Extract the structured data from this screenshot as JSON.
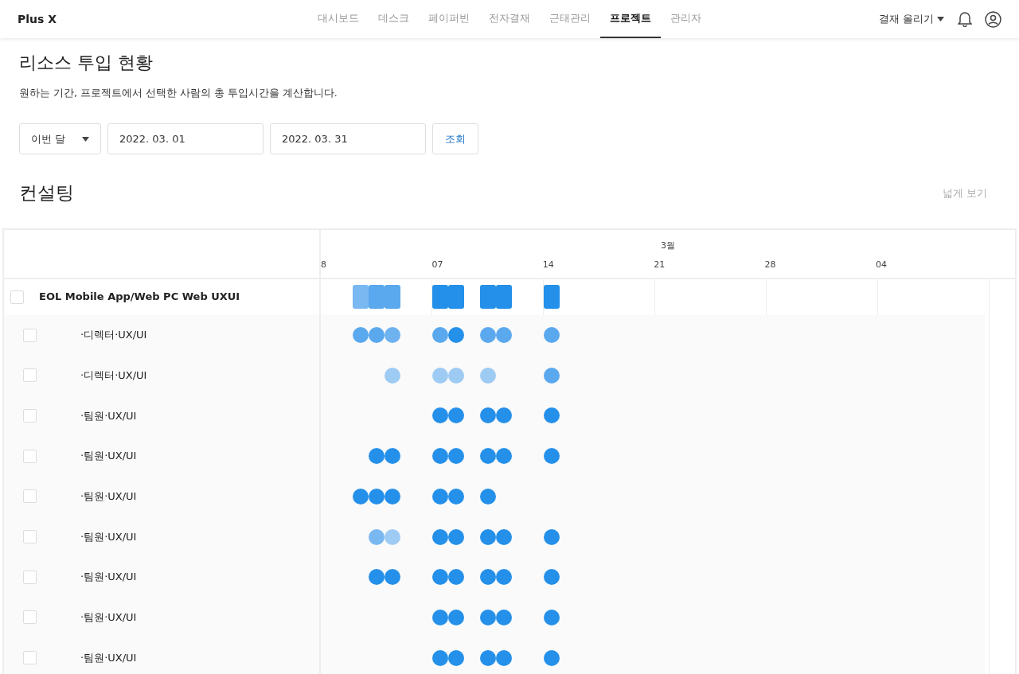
{
  "brand": "Plus X",
  "nav": [
    {
      "label": "대시보드",
      "selected": false
    },
    {
      "label": "데스크",
      "selected": false
    },
    {
      "label": "페이퍼빈",
      "selected": false
    },
    {
      "label": "전자결재",
      "selected": false
    },
    {
      "label": "근태관리",
      "selected": false
    },
    {
      "label": "프로젝트",
      "selected": true
    },
    {
      "label": "관리자",
      "selected": false
    }
  ],
  "approval_menu": "결재 올리기",
  "page": {
    "title": "리소스 투입 현황",
    "description": "원하는 기간, 프로젝트에서 선택한 사람의 총 투입시간을 계산합니다."
  },
  "filters": {
    "period": "이번 달",
    "start_date": "2022. 03. 01",
    "end_date": "2022. 03. 31",
    "search_button": "조회"
  },
  "section": {
    "title": "컨설팅",
    "expand_link": "넓게 보기"
  },
  "timeline": {
    "month": "3월",
    "ticks": [
      "8",
      "07",
      "14",
      "21",
      "28",
      "04"
    ]
  },
  "rows": [
    {
      "kind": "project",
      "label": "EOL Mobile App/Web PC Web UXUI",
      "checked": false,
      "days": [
        {
          "booked": false
        },
        {
          "booked": false
        },
        {
          "booked": true,
          "color": "#7ab8f2"
        },
        {
          "booked": true,
          "color": "#5aa8ee"
        },
        {
          "booked": true,
          "color": "#5aa8ee"
        },
        {
          "booked": false
        },
        {
          "booked": false
        },
        {
          "booked": true,
          "color": "#2490ea"
        },
        {
          "booked": true,
          "color": "#2490ea"
        },
        {
          "booked": false
        },
        {
          "booked": true,
          "color": "#2490ea"
        },
        {
          "booked": true,
          "color": "#2490ea"
        },
        {
          "booked": false
        },
        {
          "booked": false
        },
        {
          "booked": true,
          "color": "#2490ea"
        }
      ]
    },
    {
      "kind": "member",
      "label": "·디렉터·UX/UI",
      "checked": false,
      "days": [
        {
          "booked": false
        },
        {
          "booked": false
        },
        {
          "booked": true,
          "color": "#5aa8ee"
        },
        {
          "booked": true,
          "color": "#5aa8ee"
        },
        {
          "booked": true,
          "color": "#6eb2f0"
        },
        {
          "booked": false
        },
        {
          "booked": false
        },
        {
          "booked": true,
          "color": "#5aa8ee"
        },
        {
          "booked": true,
          "color": "#2490ea"
        },
        {
          "booked": false
        },
        {
          "booked": true,
          "color": "#5aa8ee"
        },
        {
          "booked": true,
          "color": "#5aa8ee"
        },
        {
          "booked": false
        },
        {
          "booked": false
        },
        {
          "booked": true,
          "color": "#5aa8ee"
        }
      ]
    },
    {
      "kind": "member",
      "label": "·디렉터·UX/UI",
      "checked": false,
      "days": [
        {
          "booked": false
        },
        {
          "booked": false
        },
        {
          "booked": false
        },
        {
          "booked": false
        },
        {
          "booked": true,
          "color": "#9ecbf4"
        },
        {
          "booked": false
        },
        {
          "booked": false
        },
        {
          "booked": true,
          "color": "#9ecbf4"
        },
        {
          "booked": true,
          "color": "#9ecbf4"
        },
        {
          "booked": false
        },
        {
          "booked": true,
          "color": "#9ecbf4"
        },
        {
          "booked": false
        },
        {
          "booked": false
        },
        {
          "booked": false
        },
        {
          "booked": true,
          "color": "#5aa8ee"
        }
      ]
    },
    {
      "kind": "member",
      "label": "·팀원·UX/UI",
      "checked": false,
      "days": [
        {
          "booked": false
        },
        {
          "booked": false
        },
        {
          "booked": false
        },
        {
          "booked": false
        },
        {
          "booked": false
        },
        {
          "booked": false
        },
        {
          "booked": false
        },
        {
          "booked": true,
          "color": "#2490ea"
        },
        {
          "booked": true,
          "color": "#2490ea"
        },
        {
          "booked": false
        },
        {
          "booked": true,
          "color": "#2490ea"
        },
        {
          "booked": true,
          "color": "#2490ea"
        },
        {
          "booked": false
        },
        {
          "booked": false
        },
        {
          "booked": true,
          "color": "#2490ea"
        }
      ]
    },
    {
      "kind": "member",
      "label": "·팀원·UX/UI",
      "checked": false,
      "days": [
        {
          "booked": false
        },
        {
          "booked": false
        },
        {
          "booked": false
        },
        {
          "booked": true,
          "color": "#2490ea"
        },
        {
          "booked": true,
          "color": "#2490ea"
        },
        {
          "booked": false
        },
        {
          "booked": false
        },
        {
          "booked": true,
          "color": "#2490ea"
        },
        {
          "booked": true,
          "color": "#2490ea"
        },
        {
          "booked": false
        },
        {
          "booked": true,
          "color": "#2490ea"
        },
        {
          "booked": true,
          "color": "#2490ea"
        },
        {
          "booked": false
        },
        {
          "booked": false
        },
        {
          "booked": true,
          "color": "#2490ea"
        }
      ]
    },
    {
      "kind": "member",
      "label": "·팀원·UX/UI",
      "checked": false,
      "days": [
        {
          "booked": false
        },
        {
          "booked": false
        },
        {
          "booked": true,
          "color": "#2490ea"
        },
        {
          "booked": true,
          "color": "#2490ea"
        },
        {
          "booked": true,
          "color": "#2490ea"
        },
        {
          "booked": false
        },
        {
          "booked": false
        },
        {
          "booked": true,
          "color": "#2490ea"
        },
        {
          "booked": true,
          "color": "#2490ea"
        },
        {
          "booked": false
        },
        {
          "booked": true,
          "color": "#2490ea"
        },
        {
          "booked": false
        },
        {
          "booked": false
        },
        {
          "booked": false
        },
        {
          "booked": false
        }
      ]
    },
    {
      "kind": "member",
      "label": "·팀원·UX/UI",
      "checked": false,
      "days": [
        {
          "booked": false
        },
        {
          "booked": false
        },
        {
          "booked": false
        },
        {
          "booked": true,
          "color": "#7ab8f2"
        },
        {
          "booked": true,
          "color": "#9ecbf4"
        },
        {
          "booked": false
        },
        {
          "booked": false
        },
        {
          "booked": true,
          "color": "#2490ea"
        },
        {
          "booked": true,
          "color": "#2490ea"
        },
        {
          "booked": false
        },
        {
          "booked": true,
          "color": "#2490ea"
        },
        {
          "booked": true,
          "color": "#2490ea"
        },
        {
          "booked": false
        },
        {
          "booked": false
        },
        {
          "booked": true,
          "color": "#2490ea"
        }
      ]
    },
    {
      "kind": "member",
      "label": "·팀원·UX/UI",
      "checked": false,
      "days": [
        {
          "booked": false
        },
        {
          "booked": false
        },
        {
          "booked": false
        },
        {
          "booked": true,
          "color": "#2490ea"
        },
        {
          "booked": true,
          "color": "#2490ea"
        },
        {
          "booked": false
        },
        {
          "booked": false
        },
        {
          "booked": true,
          "color": "#2490ea"
        },
        {
          "booked": true,
          "color": "#2490ea"
        },
        {
          "booked": false
        },
        {
          "booked": true,
          "color": "#2490ea"
        },
        {
          "booked": true,
          "color": "#2490ea"
        },
        {
          "booked": false
        },
        {
          "booked": false
        },
        {
          "booked": true,
          "color": "#2490ea"
        }
      ]
    },
    {
      "kind": "member",
      "label": "·팀원·UX/UI",
      "checked": false,
      "days": [
        {
          "booked": false
        },
        {
          "booked": false
        },
        {
          "booked": false
        },
        {
          "booked": false
        },
        {
          "booked": false
        },
        {
          "booked": false
        },
        {
          "booked": false
        },
        {
          "booked": true,
          "color": "#2490ea"
        },
        {
          "booked": true,
          "color": "#2490ea"
        },
        {
          "booked": false
        },
        {
          "booked": true,
          "color": "#2490ea"
        },
        {
          "booked": true,
          "color": "#2490ea"
        },
        {
          "booked": false
        },
        {
          "booked": false
        },
        {
          "booked": true,
          "color": "#2490ea"
        }
      ]
    },
    {
      "kind": "member",
      "label": "·팀원·UX/UI",
      "checked": false,
      "days": [
        {
          "booked": false
        },
        {
          "booked": false
        },
        {
          "booked": false
        },
        {
          "booked": false
        },
        {
          "booked": false
        },
        {
          "booked": false
        },
        {
          "booked": false
        },
        {
          "booked": true,
          "color": "#2490ea"
        },
        {
          "booked": true,
          "color": "#2490ea"
        },
        {
          "booked": false
        },
        {
          "booked": true,
          "color": "#2490ea"
        },
        {
          "booked": true,
          "color": "#2490ea"
        },
        {
          "booked": false
        },
        {
          "booked": false
        },
        {
          "booked": true,
          "color": "#2490ea"
        }
      ]
    }
  ]
}
